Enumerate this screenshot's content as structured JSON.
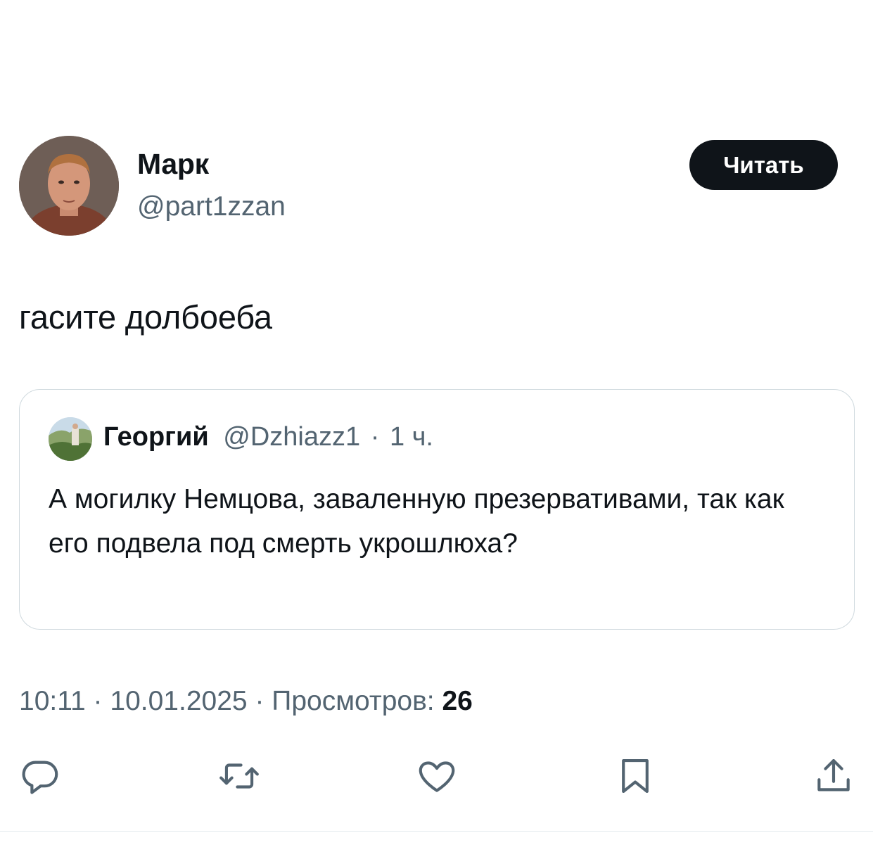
{
  "author": {
    "name": "Марк",
    "handle": "@part1zzan",
    "follow_label": "Читать"
  },
  "tweet": {
    "text": "гасите долбоеба"
  },
  "quote": {
    "name": "Георгий",
    "handle": "@Dzhiazz1",
    "separator": "·",
    "time": "1 ч.",
    "text": "А могилку Немцова, заваленную презервативами, так как его подвела под смерть укрошлюха?"
  },
  "meta": {
    "time": "10:11",
    "separator": "·",
    "date": "10.01.2025",
    "views_label": "Просмотров:",
    "views_count": "26"
  },
  "actions": {
    "icons": [
      "reply-icon",
      "retweet-icon",
      "like-icon",
      "bookmark-icon",
      "share-icon"
    ]
  },
  "colors": {
    "text_primary": "#0f1419",
    "text_secondary": "#536471",
    "border": "#cfd9de",
    "button_bg": "#0f1419",
    "button_text": "#ffffff"
  }
}
